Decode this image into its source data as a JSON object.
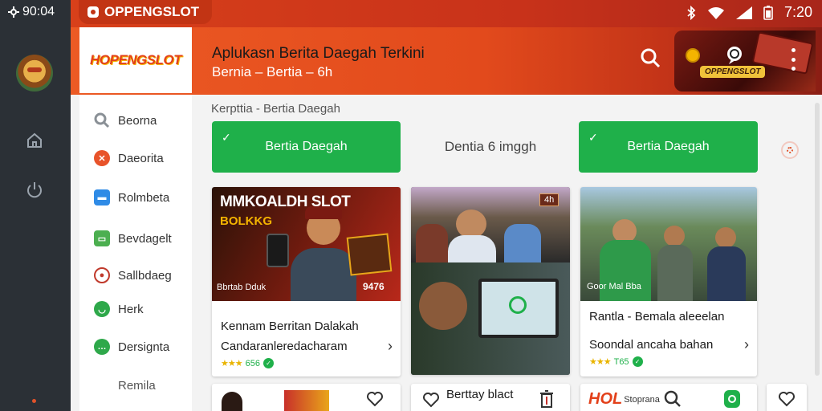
{
  "rail": {
    "time": "90:04"
  },
  "status": {
    "app_name": "OPPENGSLOT",
    "time": "7:20"
  },
  "header": {
    "logo": "HOPENGSLOT",
    "title": "Aplukasn Berita Daegah Terkini",
    "subtitle": "Bernia – Bertia – 6h",
    "promo_label": "OPPENGSLOT"
  },
  "sidebar": {
    "items": [
      {
        "label": "Beorna",
        "icon": "search-icon",
        "color": "#9aa0a6"
      },
      {
        "label": "Daeorita",
        "icon": "flame-icon",
        "color": "#e8532a"
      },
      {
        "label": "Rolmbeta",
        "icon": "news-icon",
        "color": "#2f8be6"
      },
      {
        "label": "Bevdagelt",
        "icon": "grid-icon",
        "color": "#4caf50"
      },
      {
        "label": "Sallbdaeg",
        "icon": "doc-icon",
        "color": "#c0392b"
      },
      {
        "label": "Herk",
        "icon": "chat-icon",
        "color": "#2ea84a"
      },
      {
        "label": "Dersignta",
        "icon": "chat-bubble-icon",
        "color": "#2ea84a"
      },
      {
        "label": "Remila",
        "icon": "",
        "color": ""
      }
    ]
  },
  "main": {
    "breadcrumb": "Kerpttia - Bertia Daegah",
    "tabs": [
      {
        "label": "Bertia Daegah",
        "active": true
      },
      {
        "label": "Dentia 6 imggh",
        "active": false
      },
      {
        "label": "Bertia Daegah",
        "active": true
      }
    ]
  },
  "cards": [
    {
      "headline": "MMKOALDH SLOT",
      "tag": "BOLKKG",
      "caption": "Bbrtab Dduk",
      "price": "9476",
      "title": "Kennam Berritan Dalakah",
      "subtitle": "Candaranleredacharam",
      "rating": "656"
    },
    {
      "badge": "4h",
      "title": "Berttay blact"
    },
    {
      "caption": "Goor Mal Bba",
      "title": "Rantla - Bemala aleeelan",
      "subtitle": "Soondal ancaha bahan",
      "rating": "T65"
    }
  ],
  "bottom": {
    "brand": "HOL",
    "brand_tail": "Stoprana"
  }
}
